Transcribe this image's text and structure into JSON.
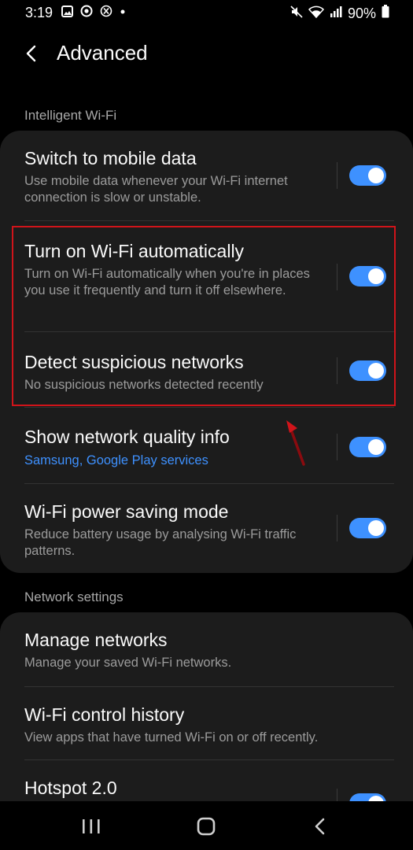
{
  "status_bar": {
    "time": "3:19",
    "battery": "90%",
    "left_icons": [
      "gallery-icon",
      "sync-icon",
      "x-app-icon",
      "dot-icon"
    ],
    "right_icons": [
      "mute-icon",
      "wifi-icon",
      "signal-icon",
      "battery-icon"
    ]
  },
  "header": {
    "title": "Advanced"
  },
  "sections": {
    "intelligent_wifi": "Intelligent Wi-Fi",
    "network_settings": "Network settings"
  },
  "intelligent_items": [
    {
      "title": "Switch to mobile data",
      "subtitle": "Use mobile data whenever your Wi-Fi internet connection is slow or unstable.",
      "toggle_on": true
    },
    {
      "title": "Turn on Wi-Fi automatically",
      "subtitle": "Turn on Wi-Fi automatically when you're in places you use it frequently and turn it off elsewhere.",
      "toggle_on": true
    },
    {
      "title": "Detect suspicious networks",
      "subtitle": "No suspicious networks detected recently",
      "toggle_on": true
    },
    {
      "title": "Show network quality info",
      "subtitle": "Samsung, Google Play services",
      "toggle_on": true
    },
    {
      "title": "Wi-Fi power saving mode",
      "subtitle": "Reduce battery usage by analysing Wi-Fi traffic patterns.",
      "toggle_on": true
    }
  ],
  "network_items": [
    {
      "title": "Manage networks",
      "subtitle": "Manage your saved Wi-Fi networks."
    },
    {
      "title": "Wi-Fi control history",
      "subtitle": "View apps that have turned Wi-Fi on or off recently."
    },
    {
      "title": "Hotspot 2.0",
      "toggle_on": true
    }
  ],
  "colors": {
    "accent": "#3e91ff",
    "background": "#000000",
    "card": "#1c1c1c",
    "highlight_annotation": "#d0141a"
  },
  "navigation_bar": [
    "recent-apps-icon",
    "home-icon",
    "back-icon"
  ]
}
